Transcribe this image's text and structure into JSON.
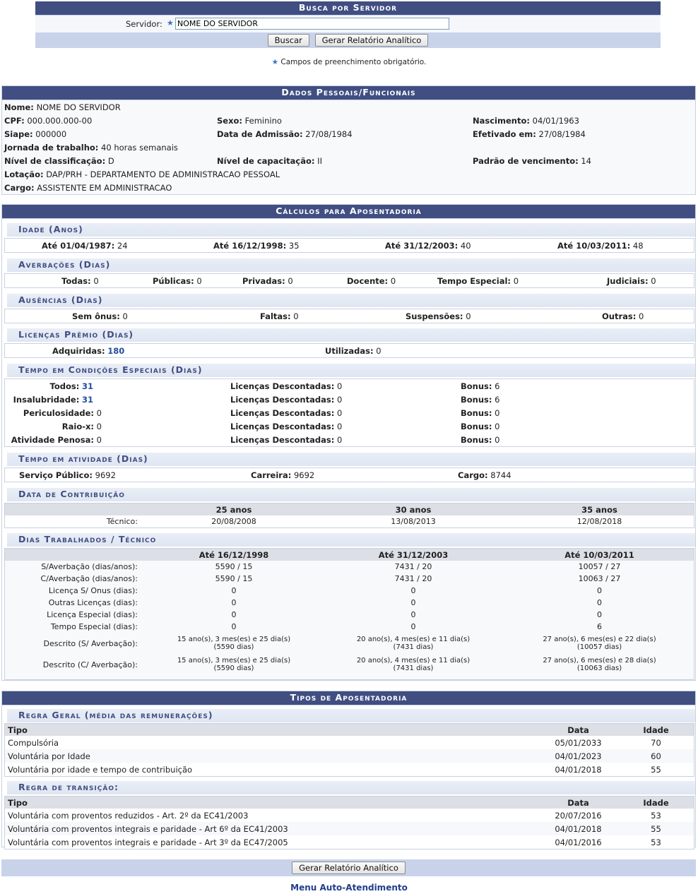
{
  "busca": {
    "title": "Busca por Servidor",
    "servidor_label": "Servidor:",
    "servidor_value": "NOME DO SERVIDOR",
    "buscar_label": "Buscar",
    "relatorio_label": "Gerar Relatório Analítico",
    "required_icon": "star-icon",
    "obrigatorio_note": "Campos de preenchimento obrigatório."
  },
  "dados": {
    "title": "Dados Pessoais/Funcionais",
    "nome_label": "Nome:",
    "nome": "NOME DO SERVIDOR",
    "cpf_label": "CPF:",
    "cpf": "000.000.000-00",
    "sexo_label": "Sexo:",
    "sexo": "Feminino",
    "nascimento_label": "Nascimento:",
    "nascimento": "04/01/1963",
    "siape_label": "Siape:",
    "siape": "000000",
    "admissao_label": "Data de Admissão:",
    "admissao": "27/08/1984",
    "efetivado_label": "Efetivado em:",
    "efetivado": "27/08/1984",
    "jornada_label": "Jornada de trabalho:",
    "jornada": "40 horas semanais",
    "classificacao_label": "Nível de classificação:",
    "classificacao": "D",
    "capacitacao_label": "Nível de capacitação:",
    "capacitacao": "II",
    "padrao_label": "Padrão de vencimento:",
    "padrao": "14",
    "lotacao_label": "Lotação:",
    "lotacao": "DAP/PRH - DEPARTAMENTO DE ADMINISTRACAO PESSOAL",
    "cargo_label": "Cargo:",
    "cargo": "ASSISTENTE EM ADMINISTRACAO"
  },
  "calculos": {
    "title": "Cálculos para Aposentadoria",
    "idade": {
      "title": "Idade (Anos)",
      "items": [
        {
          "label": "Até 01/04/1987:",
          "value": "24"
        },
        {
          "label": "Até 16/12/1998:",
          "value": "35"
        },
        {
          "label": "Até 31/12/2003:",
          "value": "40"
        },
        {
          "label": "Até 10/03/2011:",
          "value": "48"
        }
      ]
    },
    "averbacoes": {
      "title": "Averbações (Dias)",
      "items": [
        {
          "label": "Todas:",
          "value": "0"
        },
        {
          "label": "Públicas:",
          "value": "0"
        },
        {
          "label": "Privadas:",
          "value": "0"
        },
        {
          "label": "Docente:",
          "value": "0"
        },
        {
          "label": "Tempo Especial:",
          "value": "0"
        },
        {
          "label": "Judiciais:",
          "value": "0"
        }
      ]
    },
    "ausencias": {
      "title": "Ausências (Dias)",
      "items": [
        {
          "label": "Sem ônus:",
          "value": "0"
        },
        {
          "label": "Faltas:",
          "value": "0"
        },
        {
          "label": "Suspensões:",
          "value": "0"
        },
        {
          "label": "Outras:",
          "value": "0"
        }
      ]
    },
    "licencas": {
      "title": "Licenças Prêmio (Dias)",
      "items": [
        {
          "label": "Adquiridas:",
          "value": "180"
        },
        {
          "label": "Utilizadas:",
          "value": "0"
        }
      ]
    },
    "especiais": {
      "title": "Tempo em Condições Especiais (Dias)",
      "rows": [
        {
          "label": "Todos:",
          "value": "31",
          "lic_label": "Licenças Descontadas:",
          "lic": "0",
          "bonus_label": "Bonus:",
          "bonus": "6"
        },
        {
          "label": "Insalubridade:",
          "value": "31",
          "lic_label": "Licenças Descontadas:",
          "lic": "0",
          "bonus_label": "Bonus:",
          "bonus": "6"
        },
        {
          "label": "Periculosidade:",
          "value": "0",
          "lic_label": "Licenças Descontadas:",
          "lic": "0",
          "bonus_label": "Bonus:",
          "bonus": "0"
        },
        {
          "label": "Raio-x:",
          "value": "0",
          "lic_label": "Licenças Descontadas:",
          "lic": "0",
          "bonus_label": "Bonus:",
          "bonus": "0"
        },
        {
          "label": "Atividade Penosa:",
          "value": "0",
          "lic_label": "Licenças Descontadas:",
          "lic": "0",
          "bonus_label": "Bonus:",
          "bonus": "0"
        }
      ]
    },
    "atividade": {
      "title": "Tempo em atividade (Dias)",
      "items": [
        {
          "label": "Serviço Público:",
          "value": "9692"
        },
        {
          "label": "Carreira:",
          "value": "9692"
        },
        {
          "label": "Cargo:",
          "value": "8744"
        }
      ]
    },
    "contribuicao": {
      "title": "Data de Contribuição",
      "headers": [
        "25 anos",
        "30 anos",
        "35 anos"
      ],
      "row_label": "Técnico:",
      "values": [
        "20/08/2008",
        "13/08/2013",
        "12/08/2018"
      ]
    },
    "dias": {
      "title": "Dias Trabalhados / Técnico",
      "headers": [
        "Até 16/12/1998",
        "Até 31/12/2003",
        "Até 10/03/2011"
      ],
      "rows": [
        {
          "label": "S/Averbação (dias/anos):",
          "values": [
            "5590 / 15",
            "7431 / 20",
            "10057 / 27"
          ]
        },
        {
          "label": "C/Averbação (dias/anos):",
          "values": [
            "5590 / 15",
            "7431 / 20",
            "10063 / 27"
          ]
        },
        {
          "label": "Licença S/ Onus (dias):",
          "values": [
            "0",
            "0",
            "0"
          ]
        },
        {
          "label": "Outras Licenças (dias):",
          "values": [
            "0",
            "0",
            "0"
          ]
        },
        {
          "label": "Licença Especial (dias):",
          "values": [
            "0",
            "0",
            "0"
          ]
        },
        {
          "label": "Tempo Especial (dias):",
          "values": [
            "0",
            "0",
            "6"
          ]
        }
      ],
      "descritos": [
        {
          "label": "Descrito (S/ Averbação):",
          "values": [
            [
              "15 ano(s), 3 mes(es) e 25 dia(s)",
              "(5590 dias)"
            ],
            [
              "20 ano(s), 4 mes(es) e 11 dia(s)",
              "(7431 dias)"
            ],
            [
              "27 ano(s), 6 mes(es) e 22 dia(s)",
              "(10057 dias)"
            ]
          ]
        },
        {
          "label": "Descrito (C/ Averbação):",
          "values": [
            [
              "15 ano(s), 3 mes(es) e 25 dia(s)",
              "(5590 dias)"
            ],
            [
              "20 ano(s), 4 mes(es) e 11 dia(s)",
              "(7431 dias)"
            ],
            [
              "27 ano(s), 6 mes(es) e 28 dia(s)",
              "(10063 dias)"
            ]
          ]
        }
      ]
    }
  },
  "tipos": {
    "title": "Tipos de Aposentadoria",
    "headers": [
      "Tipo",
      "Data",
      "Idade"
    ],
    "geral": {
      "title": "Regra Geral (média das remunerações)",
      "rows": [
        [
          "Compulsória",
          "05/01/2033",
          "70"
        ],
        [
          "Voluntária por Idade",
          "04/01/2023",
          "60"
        ],
        [
          "Voluntária por idade e tempo de contribuição",
          "04/01/2018",
          "55"
        ]
      ]
    },
    "transicao": {
      "title": "Regra de transição:",
      "rows": [
        [
          "Voluntária com proventos reduzidos - Art. 2º da EC41/2003",
          "20/07/2016",
          "53"
        ],
        [
          "Voluntária com proventos integrais e paridade - Art 6º da EC41/2003",
          "04/01/2018",
          "55"
        ],
        [
          "Voluntária com proventos integrais e paridade - Art 3º da EC47/2005",
          "04/01/2016",
          "53"
        ]
      ]
    }
  },
  "footer": {
    "relatorio_label": "Gerar Relatório Analítico",
    "menu_link": "Menu Auto-Atendimento"
  }
}
